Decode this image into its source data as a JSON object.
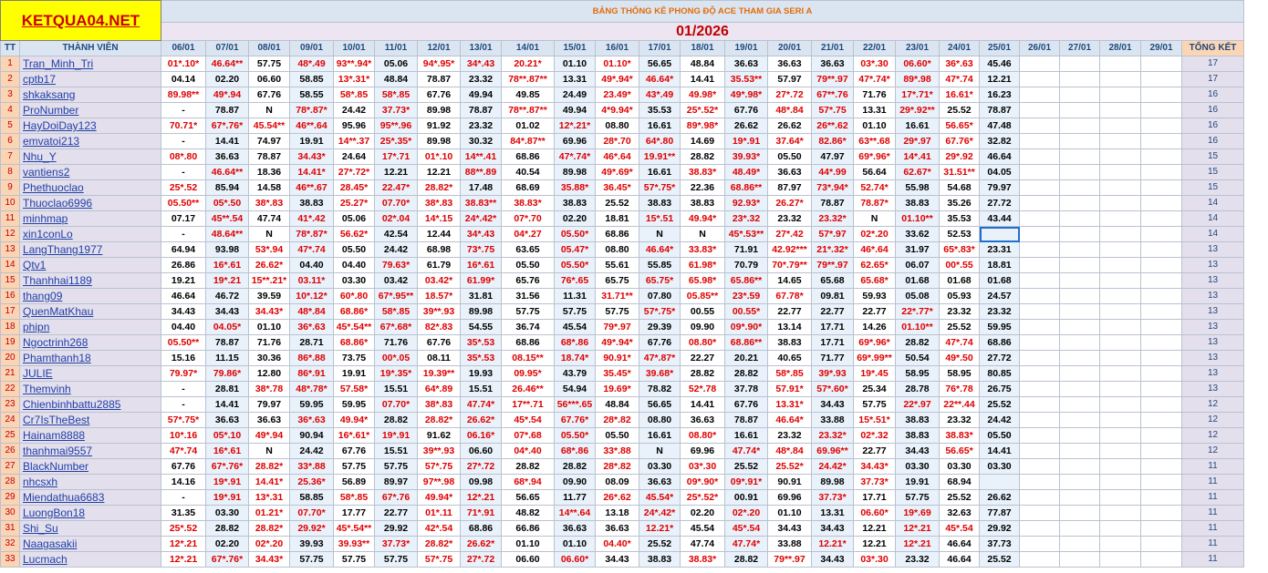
{
  "logo": "KETQUA04.NET",
  "title": "BẢNG THỐNG KÊ PHONG ĐỘ ACE THAM GIA SERI A",
  "month": "01/2026",
  "header": {
    "tt": "TT",
    "member": "THÀNH VIÊN",
    "total": "TỔNG KẾT"
  },
  "dates": [
    "06/01",
    "07/01",
    "08/01",
    "09/01",
    "10/01",
    "11/01",
    "12/01",
    "13/01",
    "14/01",
    "15/01",
    "16/01",
    "17/01",
    "18/01",
    "19/01",
    "20/01",
    "21/01",
    "22/01",
    "23/01",
    "24/01",
    "25/01",
    "26/01",
    "27/01",
    "28/01",
    "29/01"
  ],
  "rows": [
    {
      "n": "1",
      "name": "Tran_Minh_Tri",
      "v": [
        "01*.10*",
        "46.64**",
        "57.75",
        "48*.49",
        "93**.94*",
        "05.06",
        "94*.95*",
        "34*.43",
        "20.21*",
        "01.10",
        "01.10*",
        "56.65",
        "48.84",
        "36.63",
        "36.63",
        "36.63",
        "03*.30",
        "06.60*",
        "36*.63",
        "45.46"
      ],
      "t": "17"
    },
    {
      "n": "2",
      "name": "cptb17",
      "v": [
        "04.14",
        "02.20",
        "06.60",
        "58.85",
        "13*.31*",
        "48.84",
        "78.87",
        "23.32",
        "78**.87**",
        "13.31",
        "49*.94*",
        "46.64*",
        "14.41",
        "35.53**",
        "57.97",
        "79**.97",
        "47*.74*",
        "89*.98",
        "47*.74",
        "12.21"
      ],
      "t": "17"
    },
    {
      "n": "3",
      "name": "shkaksang",
      "v": [
        "89.98**",
        "49*.94",
        "67.76",
        "58.55",
        "58*.85",
        "58*.85",
        "67.76",
        "49.94",
        "49.85",
        "24.49",
        "23.49*",
        "43*.49",
        "49.98*",
        "49*.98*",
        "27*.72",
        "67**.76",
        "71.76",
        "17*.71*",
        "16.61*",
        "16.23"
      ],
      "t": "16"
    },
    {
      "n": "4",
      "name": "ProNumber",
      "v": [
        "-",
        "78.87",
        "N",
        "78*.87*",
        "24.42",
        "37.73*",
        "89.98",
        "78.87",
        "78**.87**",
        "49.94",
        "4*9.94*",
        "35.53",
        "25*.52*",
        "67.76",
        "48*.84",
        "57*.75",
        "13.31",
        "29*.92**",
        "25.52",
        "78.87"
      ],
      "t": "16"
    },
    {
      "n": "5",
      "name": "HayDoiDay123",
      "v": [
        "70.71*",
        "67*.76*",
        "45.54**",
        "46**.64",
        "95.96",
        "95**.96",
        "91.92",
        "23.32",
        "01.02",
        "12*.21*",
        "08.80",
        "16.61",
        "89*.98*",
        "26.62",
        "26.62",
        "26**.62",
        "01.10",
        "16.61",
        "56.65*",
        "47.48"
      ],
      "t": "16"
    },
    {
      "n": "6",
      "name": "emvatoi213",
      "v": [
        "-",
        "14.41",
        "74.97",
        "19.91",
        "14**.37",
        "25*.35*",
        "89.98",
        "30.32",
        "84*.87**",
        "69.96",
        "28*.70",
        "64*.80",
        "14.69",
        "19*.91",
        "37.64*",
        "82.86*",
        "63**.68",
        "29*.97",
        "67.76*",
        "32.82"
      ],
      "t": "16"
    },
    {
      "n": "7",
      "name": "Nhu_Y",
      "v": [
        "08*.80",
        "36.63",
        "78.87",
        "34.43*",
        "24.64",
        "17*.71",
        "01*.10",
        "14**.41",
        "68.86",
        "47*.74*",
        "46*.64",
        "19.91**",
        "28.82",
        "39.93*",
        "05.50",
        "47.97",
        "69*.96*",
        "14*.41",
        "29*.92",
        "46.64"
      ],
      "t": "15"
    },
    {
      "n": "8",
      "name": "vantiens2",
      "v": [
        "-",
        "46.64**",
        "18.36",
        "14.41*",
        "27*.72*",
        "12.21",
        "12.21",
        "88**.89",
        "40.54",
        "89.98",
        "49*.69*",
        "16.61",
        "38.83*",
        "48.49*",
        "36.63",
        "44*.99",
        "56.64",
        "62.67*",
        "31.51**",
        "04.05"
      ],
      "t": "15"
    },
    {
      "n": "9",
      "name": "Phethuoclao",
      "v": [
        "25*.52",
        "85.94",
        "14.58",
        "46**.67",
        "28.45*",
        "22.47*",
        "28.82*",
        "17.48",
        "68.69",
        "35.88*",
        "36.45*",
        "57*.75*",
        "22.36",
        "68.86**",
        "87.97",
        "73*.94*",
        "52.74*",
        "55.98",
        "54.68",
        "79.97"
      ],
      "t": "15"
    },
    {
      "n": "10",
      "name": "Thuoclao6996",
      "v": [
        "05.50**",
        "05*.50",
        "38*.83",
        "38.83",
        "25.27*",
        "07.70*",
        "38*.83",
        "38.83**",
        "38.83*",
        "38.83",
        "25.52",
        "38.83",
        "38.83",
        "92.93*",
        "26.27*",
        "78.87",
        "78.87*",
        "38.83",
        "35.26",
        "27.72"
      ],
      "t": "14"
    },
    {
      "n": "11",
      "name": "minhmap",
      "v": [
        "07.17",
        "45**.54",
        "47.74",
        "41*.42",
        "05.06",
        "02*.04",
        "14*.15",
        "24*.42*",
        "07*.70",
        "02.20",
        "18.81",
        "15*.51",
        "49.94*",
        "23*.32",
        "23.32",
        "23.32*",
        "N",
        "01.10**",
        "35.53",
        "43.44"
      ],
      "t": "14"
    },
    {
      "n": "12",
      "name": "xin1conLo",
      "v": [
        "-",
        "48.64**",
        "N",
        "78*.87*",
        "56.62*",
        "42.54",
        "12.44",
        "34*.43",
        "04*.27",
        "05.50*",
        "68.86",
        "N",
        "N",
        "45*.53**",
        "27*.42",
        "57*.97",
        "02*.20",
        "33.62",
        "52.53",
        ""
      ],
      "t": "14"
    },
    {
      "n": "13",
      "name": "LangThang1977",
      "v": [
        "64.94",
        "93.98",
        "53*.94",
        "47*.74",
        "05.50",
        "24.42",
        "68.98",
        "73*.75",
        "63.65",
        "05.47*",
        "08.80",
        "46.64*",
        "33.83*",
        "71.91",
        "42.92***",
        "21*.32*",
        "46*.64",
        "31.97",
        "65*.83*",
        "23.31"
      ],
      "t": "13"
    },
    {
      "n": "14",
      "name": "Qtv1",
      "v": [
        "26.86",
        "16*.61",
        "26.62*",
        "04.40",
        "04.40",
        "79.63*",
        "61.79",
        "16*.61",
        "05.50",
        "05.50*",
        "55.61",
        "55.85",
        "61.98*",
        "70.79",
        "70*.79**",
        "79**.97",
        "62.65*",
        "06.07",
        "00*.55",
        "18.81"
      ],
      "t": "13"
    },
    {
      "n": "15",
      "name": "Thanhhai1189",
      "v": [
        "19.21",
        "19*.21",
        "15**.21*",
        "03.11*",
        "03.30",
        "03.42",
        "03.42*",
        "61.99*",
        "65.76",
        "76*.65",
        "65.75",
        "65.75*",
        "65.98*",
        "65.86**",
        "14.65",
        "65.68",
        "65.68*",
        "01.68",
        "01.68",
        "01.68"
      ],
      "t": "13"
    },
    {
      "n": "16",
      "name": "thang09",
      "v": [
        "46.64",
        "46.72",
        "39.59",
        "10*.12*",
        "60*.80",
        "67*.95**",
        "18.57*",
        "31.81",
        "31.56",
        "11.31",
        "31.71**",
        "07.80",
        "05.85**",
        "23*.59",
        "67.78*",
        "09.81",
        "59.93",
        "05.08",
        "05.93",
        "24.57"
      ],
      "t": "13"
    },
    {
      "n": "17",
      "name": "QuenMatKhau",
      "v": [
        "34.43",
        "34.43",
        "34.43*",
        "48*.84",
        "68.86*",
        "58*.85",
        "39**.93",
        "89.98",
        "57.75",
        "57.75",
        "57.75",
        "57*.75*",
        "00.55",
        "00.55*",
        "22.77",
        "22.77",
        "22.77",
        "22*.77*",
        "23.32",
        "23.32"
      ],
      "t": "13"
    },
    {
      "n": "18",
      "name": "phipn",
      "v": [
        "04.40",
        "04.05*",
        "01.10",
        "36*.63",
        "45*.54**",
        "67*.68*",
        "82*.83",
        "54.55",
        "36.74",
        "45.54",
        "79*.97",
        "29.39",
        "09.90",
        "09*.90*",
        "13.14",
        "17.71",
        "14.26",
        "01.10**",
        "25.52",
        "59.95"
      ],
      "t": "13"
    },
    {
      "n": "19",
      "name": "Ngoctrinh268",
      "v": [
        "05.50**",
        "78.87",
        "71.76",
        "28.71",
        "68.86*",
        "71.76",
        "67.76",
        "35*.53",
        "68.86",
        "68*.86",
        "49*.94*",
        "67.76",
        "08.80*",
        "68.86**",
        "38.83",
        "17.71",
        "69*.96*",
        "28.82",
        "47*.74",
        "68.86"
      ],
      "t": "13"
    },
    {
      "n": "20",
      "name": "Phamthanh18",
      "v": [
        "15.16",
        "11.15",
        "30.36",
        "86*.88",
        "73.75",
        "00*.05",
        "08.11",
        "35*.53",
        "08.15**",
        "18.74*",
        "90.91*",
        "47*.87*",
        "22.27",
        "20.21",
        "40.65",
        "71.77",
        "69*.99**",
        "50.54",
        "49*.50",
        "27.72"
      ],
      "t": "13"
    },
    {
      "n": "21",
      "name": "JULIE",
      "v": [
        "79.97*",
        "79.86*",
        "12.80",
        "86*.91",
        "19.91",
        "19*.35*",
        "19.39**",
        "19.93",
        "09.95*",
        "43.79",
        "35.45*",
        "39.68*",
        "28.82",
        "28.82",
        "58*.85",
        "39*.93",
        "19*.45",
        "58.95",
        "58.95",
        "80.85"
      ],
      "t": "13"
    },
    {
      "n": "22",
      "name": "Themvinh",
      "v": [
        "-",
        "28.81",
        "38*.78",
        "48*.78*",
        "57.58*",
        "15.51",
        "64*.89",
        "15.51",
        "26.46**",
        "54.94",
        "19.69*",
        "78.82",
        "52*.78",
        "37.78",
        "57.91*",
        "57*.60*",
        "25.34",
        "28.78",
        "76*.78",
        "26.75"
      ],
      "t": "13"
    },
    {
      "n": "23",
      "name": "Chienbinhbattu2885",
      "v": [
        "-",
        "14.41",
        "79.97",
        "59.95",
        "59.95",
        "07.70*",
        "38*.83",
        "47.74*",
        "17**.71",
        "56***.65",
        "48.84",
        "56.65",
        "14.41",
        "67.76",
        "13.31*",
        "34.43",
        "57.75",
        "22*.97",
        "22**.44",
        "25.52"
      ],
      "t": "12"
    },
    {
      "n": "24",
      "name": "Cr7IsTheBest",
      "v": [
        "57*.75*",
        "36.63",
        "36.63",
        "36*.63",
        "49.94*",
        "28.82",
        "28.82*",
        "26.62*",
        "45*.54",
        "67.76*",
        "28*.82",
        "08.80",
        "36.63",
        "78.87",
        "46.64*",
        "33.88",
        "15*.51*",
        "38.83",
        "23.32",
        "24.42"
      ],
      "t": "12"
    },
    {
      "n": "25",
      "name": "Hainam8888",
      "v": [
        "10*.16",
        "05*.10",
        "49*.94",
        "90.94",
        "16*.61*",
        "19*.91",
        "91.62",
        "06.16*",
        "07*.68",
        "05.50*",
        "05.50",
        "16.61",
        "08.80*",
        "16.61",
        "23.32",
        "23.32*",
        "02*.32",
        "38.83",
        "38.83*",
        "05.50"
      ],
      "t": "12"
    },
    {
      "n": "26",
      "name": "thanhmai9557",
      "v": [
        "47*.74",
        "16*.61",
        "N",
        "24.42",
        "67.76",
        "15.51",
        "39**.93",
        "06.60",
        "04*.40",
        "68*.86",
        "33*.88",
        "N",
        "69.96",
        "47.74*",
        "48*.84",
        "69.96**",
        "22.77",
        "34.43",
        "56.65*",
        "14.41"
      ],
      "t": "12"
    },
    {
      "n": "27",
      "name": "BlackNumber",
      "v": [
        "67.76",
        "67*.76*",
        "28.82*",
        "33*.88",
        "57.75",
        "57.75",
        "57*.75",
        "27*.72",
        "28.82",
        "28.82",
        "28*.82",
        "03.30",
        "03*.30",
        "25.52",
        "25.52*",
        "24.42*",
        "34.43*",
        "03.30",
        "03.30",
        "03.30"
      ],
      "t": "11"
    },
    {
      "n": "28",
      "name": "nhcsxh",
      "v": [
        "14.16",
        "19*.91",
        "14.41*",
        "25.36*",
        "56.89",
        "89.97",
        "97**.98",
        "09.98",
        "68*.94",
        "09.90",
        "08.09",
        "36.63",
        "09*.90*",
        "09*.91*",
        "90.91",
        "89.98",
        "37.73*",
        "19.91",
        "68.94"
      ],
      "t": "11"
    },
    {
      "n": "29",
      "name": "Miendathua6683",
      "v": [
        "-",
        "19*.91",
        "13*.31",
        "58.85",
        "58*.85",
        "67*.76",
        "49.94*",
        "12*.21",
        "56.65",
        "11.77",
        "26*.62",
        "45.54*",
        "25*.52*",
        "00.91",
        "69.96",
        "37.73*",
        "17.71",
        "57.75",
        "25.52",
        "26.62"
      ],
      "t": "11"
    },
    {
      "n": "30",
      "name": "LuongBon18",
      "v": [
        "31.35",
        "03.30",
        "01.21*",
        "07.70*",
        "17.77",
        "22.77",
        "01*.11",
        "71*.91",
        "48.82",
        "14**.64",
        "13.18",
        "24*.42*",
        "02.20",
        "02*.20",
        "01.10",
        "13.31",
        "06.60*",
        "19*.69",
        "32.63",
        "77.87"
      ],
      "t": "11"
    },
    {
      "n": "31",
      "name": "Shi_Su",
      "v": [
        "25*.52",
        "28.82",
        "28.82*",
        "29.92*",
        "45*.54**",
        "29.92",
        "42*.54",
        "68.86",
        "66.86",
        "36.63",
        "36.63",
        "12.21*",
        "45.54",
        "45*.54",
        "34.43",
        "34.43",
        "12.21",
        "12*.21",
        "45*.54",
        "29.92"
      ],
      "t": "11"
    },
    {
      "n": "32",
      "name": "Naagasakii",
      "v": [
        "12*.21",
        "02.20",
        "02*.20",
        "39.93",
        "39.93**",
        "37.73*",
        "28.82*",
        "26.62*",
        "01.10",
        "01.10",
        "04.40*",
        "25.52",
        "47.74",
        "47.74*",
        "33.88",
        "12.21*",
        "12.21",
        "12*.21",
        "46.64",
        "37.73"
      ],
      "t": "11"
    },
    {
      "n": "33",
      "name": "Lucmach",
      "v": [
        "12*.21",
        "67*.76*",
        "34.43*",
        "57.75",
        "57.75",
        "57.75",
        "57*.75",
        "27*.72",
        "06.60",
        "06.60*",
        "34.43",
        "38.83",
        "38.83*",
        "28.82",
        "79**.97",
        "34.43",
        "03*.30",
        "23.32",
        "46.64",
        "25.52"
      ],
      "t": "11"
    }
  ]
}
